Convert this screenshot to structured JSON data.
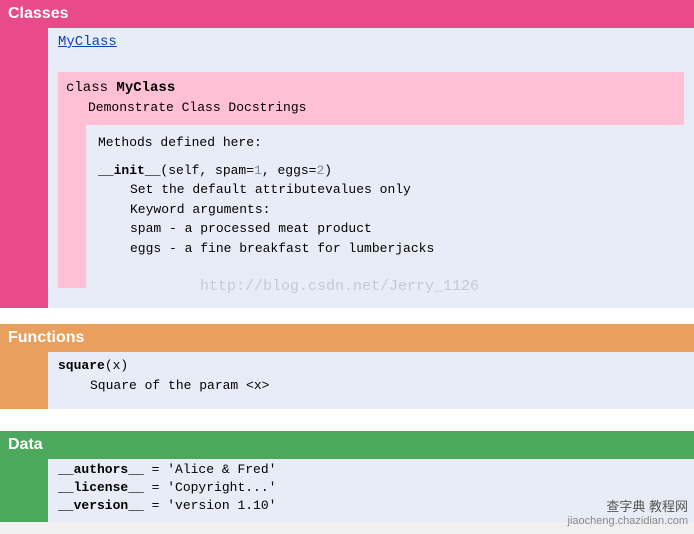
{
  "sections": {
    "classes": {
      "heading": "Classes",
      "link": "MyClass",
      "class_keyword": "class ",
      "class_name": "MyClass",
      "docstring": "Demonstrate Class Docstrings",
      "methods_header": "Methods defined here:",
      "init_name": "__init__",
      "init_sig_open": "(self, spam=",
      "init_default1": "1",
      "init_sig_mid": ", eggs=",
      "init_default2": "2",
      "init_sig_close": ")",
      "init_doc1": "Set the default attributevalues only",
      "init_doc2": "Keyword arguments:",
      "init_doc3": "spam - a processed meat product",
      "init_doc4": "eggs - a fine breakfast for lumberjacks"
    },
    "functions": {
      "heading": "Functions",
      "fn_name": "square",
      "fn_sig": "(x)",
      "fn_doc": "Square of the param <x>"
    },
    "data": {
      "heading": "Data",
      "row1_name": "__authors__",
      "row1_val": " = 'Alice & Fred'",
      "row2_name": "__license__",
      "row2_val": " = 'Copyright...'",
      "row3_name": "__version__",
      "row3_val": " = 'version 1.10'"
    }
  },
  "watermark_url": "http://blog.csdn.net/Jerry_1126",
  "watermark_cn": "查字典  教程网",
  "watermark_domain": "jiaocheng.chazidian.com"
}
